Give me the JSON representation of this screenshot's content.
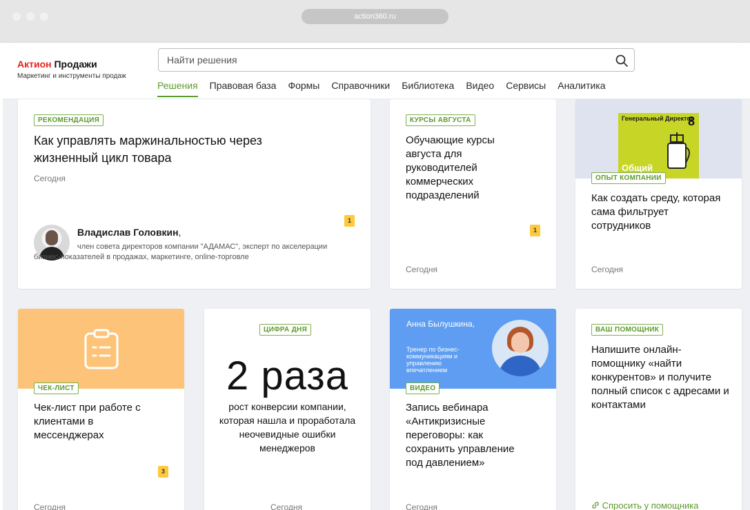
{
  "browser": {
    "url": "action360.ru"
  },
  "header": {
    "logo_brand": "Актион",
    "logo_product": "Продажи",
    "logo_subtitle": "Маркетинг и инструменты продаж",
    "search_placeholder": "Найти решения",
    "nav": [
      "Решения",
      "Правовая база",
      "Формы",
      "Справочники",
      "Библиотека",
      "Видео",
      "Сервисы",
      "Аналитика"
    ],
    "nav_active": "Решения"
  },
  "cards": {
    "c1": {
      "badge": "РЕКОМЕНДАЦИЯ",
      "title": "Как управлять маржинальностью через жизненный цикл товара",
      "date": "Сегодня",
      "author_name": "Владислав Головкин",
      "author_comma": ",",
      "author_bio": "член совета директоров компании \"АДАМАС\", эксперт по акселерации бизнес-показателей в продажах, маркетинге, online-торговле",
      "count": "1"
    },
    "c2": {
      "badge": "КУРСЫ АВГУСТА",
      "title": "Обучающие курсы августа для руководителей коммерческих подразделений",
      "date": "Сегодня",
      "count": "1"
    },
    "c3": {
      "magazine_title": "Генеральный Директор",
      "magazine_issue": "8",
      "magazine_word": "Общий",
      "badge": "ОПЫТ КОМПАНИИ",
      "title": "Как создать среду, которая сама фильтрует сотрудников",
      "date": "Сегодня"
    },
    "c4": {
      "badge": "ЧЕК-ЛИСТ",
      "title": "Чек-лист при работе с клиентами в мессенджерах",
      "date": "Сегодня",
      "count": "3"
    },
    "c5": {
      "badge": "ЦИФРА ДНЯ",
      "big": "2 раза",
      "text": "рост конверсии компании, которая нашла и проработала неочевидные ошибки менеджеров",
      "date": "Сегодня"
    },
    "c6": {
      "speaker_name": "Анна Былушкина,",
      "speaker_role": "Тренер по бизнес-коммуникациям и управлению впечатлением",
      "badge": "ВИДЕО",
      "title": "Запись вебинара «Антикризисные переговоры: как сохранить управление под давлением»",
      "date": "Сегодня"
    },
    "c7": {
      "badge": "ВАШ ПОМОЩНИК",
      "title": "Напишите онлайн-помощнику «найти конкурентов» и получите полный список с адресами и контактами",
      "link": "Спросить у помощника"
    }
  },
  "colors": {
    "accent": "#5c9a2a",
    "brand_red": "#e3241b",
    "counter": "#ffc93c",
    "orange": "#fdc479",
    "blue": "#5e9df2"
  }
}
